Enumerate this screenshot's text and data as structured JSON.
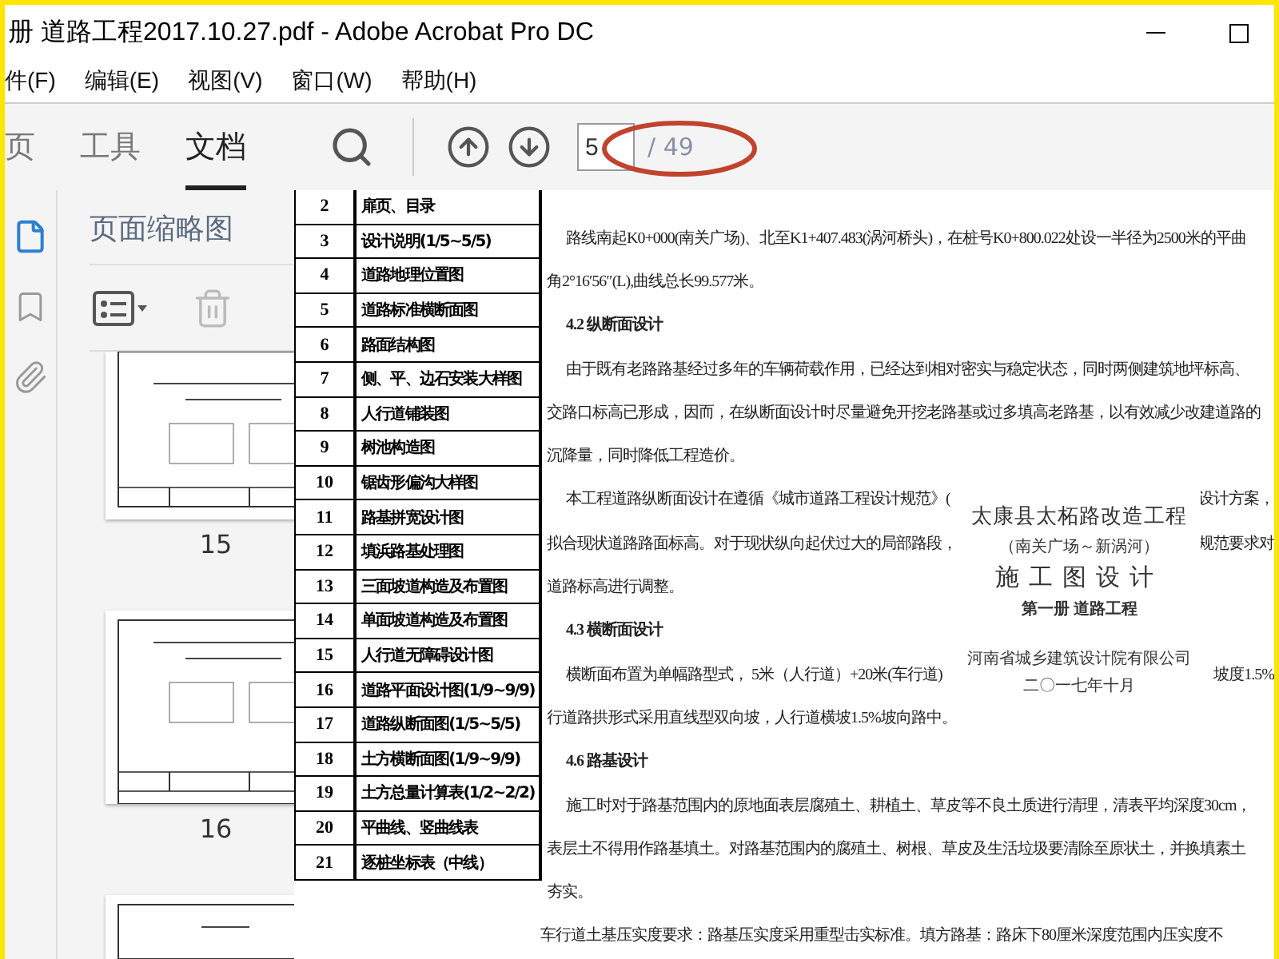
{
  "window": {
    "title": "册 道路工程2017.10.27.pdf - Adobe Acrobat Pro DC"
  },
  "menu": [
    "件(F)",
    "编辑(E)",
    "视图(V)",
    "窗口(W)",
    "帮助(H)"
  ],
  "toolbar": {
    "tabs": [
      {
        "label": "页",
        "selected": false
      },
      {
        "label": "工具",
        "selected": false
      },
      {
        "label": "文档",
        "selected": true
      }
    ],
    "page_field": {
      "value": "5"
    },
    "page_total": "/ 49"
  },
  "sidebar": {
    "rail": [
      {
        "kind": "pages",
        "selected": true
      },
      {
        "kind": "bookmarks",
        "selected": false
      },
      {
        "kind": "attachments",
        "selected": false
      }
    ],
    "panel_title": "页面缩略图",
    "thumbnails": [
      {
        "kind": "cut",
        "label": "15"
      },
      {
        "kind": "full",
        "label": "16"
      },
      {
        "kind": "partial"
      }
    ]
  },
  "drawing_list": {
    "rows": [
      {
        "number": "2",
        "title": "扉页、目录"
      },
      {
        "number": "3",
        "title": "设计说明(1/5~5/5)"
      },
      {
        "number": "4",
        "title": "道路地理位置图"
      },
      {
        "number": "5",
        "title": "道路标准横断面图"
      },
      {
        "number": "6",
        "title": "路面结构图"
      },
      {
        "number": "7",
        "title": "侧、平、边石安装大样图"
      },
      {
        "number": "8",
        "title": "人行道铺装图"
      },
      {
        "number": "9",
        "title": "树池构造图"
      },
      {
        "number": "10",
        "title": "锯齿形偏沟大样图"
      },
      {
        "number": "11",
        "title": "路基拼宽设计图"
      },
      {
        "number": "12",
        "title": "填浜路基处理图"
      },
      {
        "number": "13",
        "title": "三面坡道构造及布置图"
      },
      {
        "number": "14",
        "title": "单面坡道构造及布置图"
      },
      {
        "number": "15",
        "title": "人行道无障碍设计图"
      },
      {
        "number": "16",
        "title": "道路平面设计图(1/9~9/9)"
      },
      {
        "number": "17",
        "title": "道路纵断面图(1/5~5/5)"
      },
      {
        "number": "18",
        "title": "土方横断面图(1/9~9/9)"
      },
      {
        "number": "19",
        "title": "土方总量计算表(1/2~2/2)"
      },
      {
        "number": "20",
        "title": "平曲线、竖曲线表"
      },
      {
        "number": "21",
        "title": "逐桩坐标表（中线）"
      }
    ]
  },
  "document": {
    "lines": [
      {
        "kind": "first",
        "text": "路线南起K0+000(南关广场)、北至K1+407.483(涡河桥头)，在桩号K0+800.022处设一半径为2500米的平曲"
      },
      {
        "kind": "cont",
        "text": "角2°16′56″(L),曲线总长99.577米。"
      },
      {
        "kind": "heading",
        "text": "4.2 纵断面设计"
      },
      {
        "kind": "first",
        "text": "由于既有老路路基经过多年的车辆荷载作用，已经达到相对密实与稳定状态，同时两侧建筑地坪标高、"
      },
      {
        "kind": "cont",
        "text": "交路口标高已形成，因而，在纵断面设计时尽量避免开挖老路基或过多填高老路基，以有效减少改建道路的"
      },
      {
        "kind": "cont",
        "text": "沉降量，同时降低工程造价。"
      },
      {
        "kind": "first",
        "text": "本工程道路纵断面设计在遵循《城市道路工程设计规范》(",
        "right": "设计方案，"
      },
      {
        "kind": "cont",
        "text": "拟合现状道路路面标高。对于现状纵向起伏过大的局部路段，",
        "right": "规范要求对"
      },
      {
        "kind": "cont",
        "text": "道路标高进行调整。"
      },
      {
        "kind": "heading",
        "text": "4.3 横断面设计"
      },
      {
        "kind": "first",
        "text": "横断面布置为单幅路型式， 5米（人行道）+20米(车行道)",
        "right": "坡度1.5%"
      },
      {
        "kind": "cont",
        "text": "行道路拱形式采用直线型双向坡，人行道横坡1.5%坡向路中。"
      },
      {
        "kind": "heading",
        "text": "4.6 路基设计"
      },
      {
        "kind": "first",
        "text": "施工时对于路基范围内的原地面表层腐殖土、耕植土、草皮等不良土质进行清理，清表平均深度30cm，"
      },
      {
        "kind": "cont",
        "text": "表层土不得用作路基填土。对路基范围内的腐殖土、树根、草皮及生活垃圾要清除至原状土，并换填素土"
      },
      {
        "kind": "cont",
        "text": "夯实。"
      },
      {
        "kind": "first",
        "text": "车行道土基压实度要求：路基压实度采用重型击实标准。填方路基：路床下80厘米深度范围内压实度不"
      }
    ],
    "cover": {
      "project": "太康县太柘路改造工程",
      "section": "（南关广场～新涡河）",
      "stage": "施工图设计",
      "volume": "第一册 道路工程",
      "company": "河南省城乡建筑设计院有限公司",
      "date": "二〇一七年十月"
    }
  }
}
